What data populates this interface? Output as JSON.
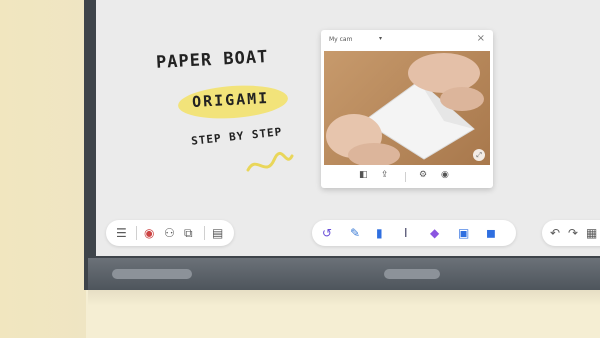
{
  "board": {
    "heading": "PAPER BOAT",
    "highlighted_word": "ORIGAMI",
    "subheading": "STEP BY STEP"
  },
  "video_window": {
    "title": "My cam",
    "dropdown_icon": "chevron-down-icon",
    "close_icon": "close-icon",
    "footer_icons": [
      "camera-switch-icon",
      "share-icon",
      "settings-icon",
      "record-icon"
    ],
    "expand_icon": "expand-icon"
  },
  "toolbar_left": {
    "icons": [
      "menu-icon",
      "record-icon",
      "user-add-icon",
      "screen-mirror-icon",
      "clipboard-icon"
    ]
  },
  "toolbar_center": {
    "icons": [
      "select-icon",
      "pen-icon",
      "highlighter-icon",
      "text-icon",
      "shapes-icon",
      "image-icon",
      "eraser-icon"
    ]
  },
  "toolbar_right": {
    "icons": [
      "undo-icon",
      "redo-icon",
      "more-icon"
    ]
  },
  "bottom_bar": {
    "left_label": "",
    "center_label": ""
  },
  "colors": {
    "highlight": "#f2e37a",
    "bezel": "#3e444a",
    "screen": "#ebebeb",
    "wall": "#f5eed3"
  }
}
